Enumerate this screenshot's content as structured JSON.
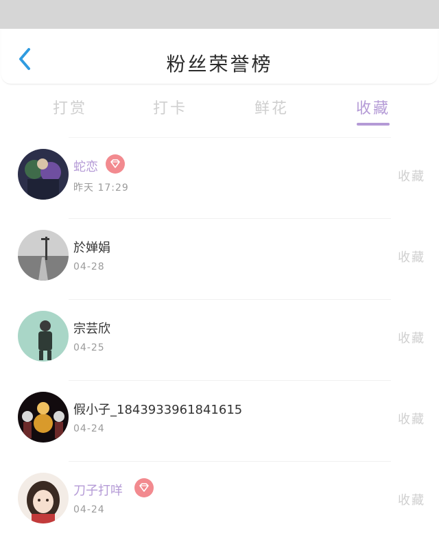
{
  "header": {
    "title": "粉丝荣誉榜"
  },
  "tabs": [
    {
      "label": "打赏",
      "active": false
    },
    {
      "label": "打卡",
      "active": false
    },
    {
      "label": "鲜花",
      "active": false
    },
    {
      "label": "收藏",
      "active": true
    }
  ],
  "fans": [
    {
      "name": "蛇恋",
      "date": "昨天 17:29",
      "vip": true,
      "action": "收藏"
    },
    {
      "name": "於婵娟",
      "date": "04-28",
      "vip": false,
      "action": "收藏"
    },
    {
      "name": "宗芸欣",
      "date": "04-25",
      "vip": false,
      "action": "收藏"
    },
    {
      "name": "假小子_1843933961841615",
      "date": "04-24",
      "vip": false,
      "action": "收藏"
    },
    {
      "name": "刀子打咩",
      "date": "04-24",
      "vip": true,
      "action": "收藏"
    }
  ],
  "colors": {
    "accent": "#b49ad6",
    "back_icon": "#2f9be0",
    "vip_badge": "#f28a8f",
    "inactive_tab": "#cfcfcf"
  },
  "icons": {
    "back": "chevron-left-icon",
    "vip": "diamond-icon"
  }
}
